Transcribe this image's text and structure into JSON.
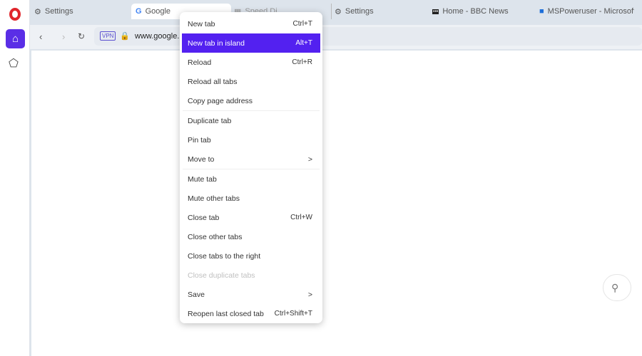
{
  "sidebar": {
    "logo": "opera-logo",
    "items": [
      {
        "icon": "home-icon"
      },
      {
        "icon": "pentagon-icon"
      }
    ]
  },
  "tabs": [
    {
      "label": "Settings",
      "icon": "gear-icon"
    },
    {
      "label": "Google",
      "icon": "google-icon",
      "active": true
    },
    {
      "label": "Speed Dial",
      "icon": "speed-dial-icon"
    },
    {
      "label": "Settings",
      "icon": "gear-icon"
    },
    {
      "label": "Home - BBC News",
      "icon": "bbc-icon"
    },
    {
      "label": "MSPoweruser - Microsoft",
      "icon": "windows-icon"
    }
  ],
  "address": {
    "vpn": "VPN",
    "url": "www.google."
  },
  "menu": [
    {
      "label": "New tab",
      "shortcut": "Ctrl+T"
    },
    {
      "label": "New tab in island",
      "shortcut": "Alt+T",
      "highlighted": true
    },
    {
      "label": "Reload",
      "shortcut": "Ctrl+R"
    },
    {
      "label": "Reload all tabs"
    },
    {
      "label": "Copy page address"
    },
    {
      "label": "Duplicate tab"
    },
    {
      "label": "Pin tab"
    },
    {
      "label": "Move to",
      "submenu": true,
      "arrow": ">"
    },
    {
      "label": "Mute tab"
    },
    {
      "label": "Mute other tabs"
    },
    {
      "label": "Close tab",
      "shortcut": "Ctrl+W"
    },
    {
      "label": "Close other tabs"
    },
    {
      "label": "Close tabs to the right"
    },
    {
      "label": "Close duplicate tabs",
      "disabled": true
    },
    {
      "label": "Save",
      "submenu": true,
      "arrow": ">"
    },
    {
      "label": "Reopen last closed tab",
      "shortcut": "Ctrl+Shift+T"
    }
  ],
  "colors": {
    "accent": "#5321f0"
  }
}
